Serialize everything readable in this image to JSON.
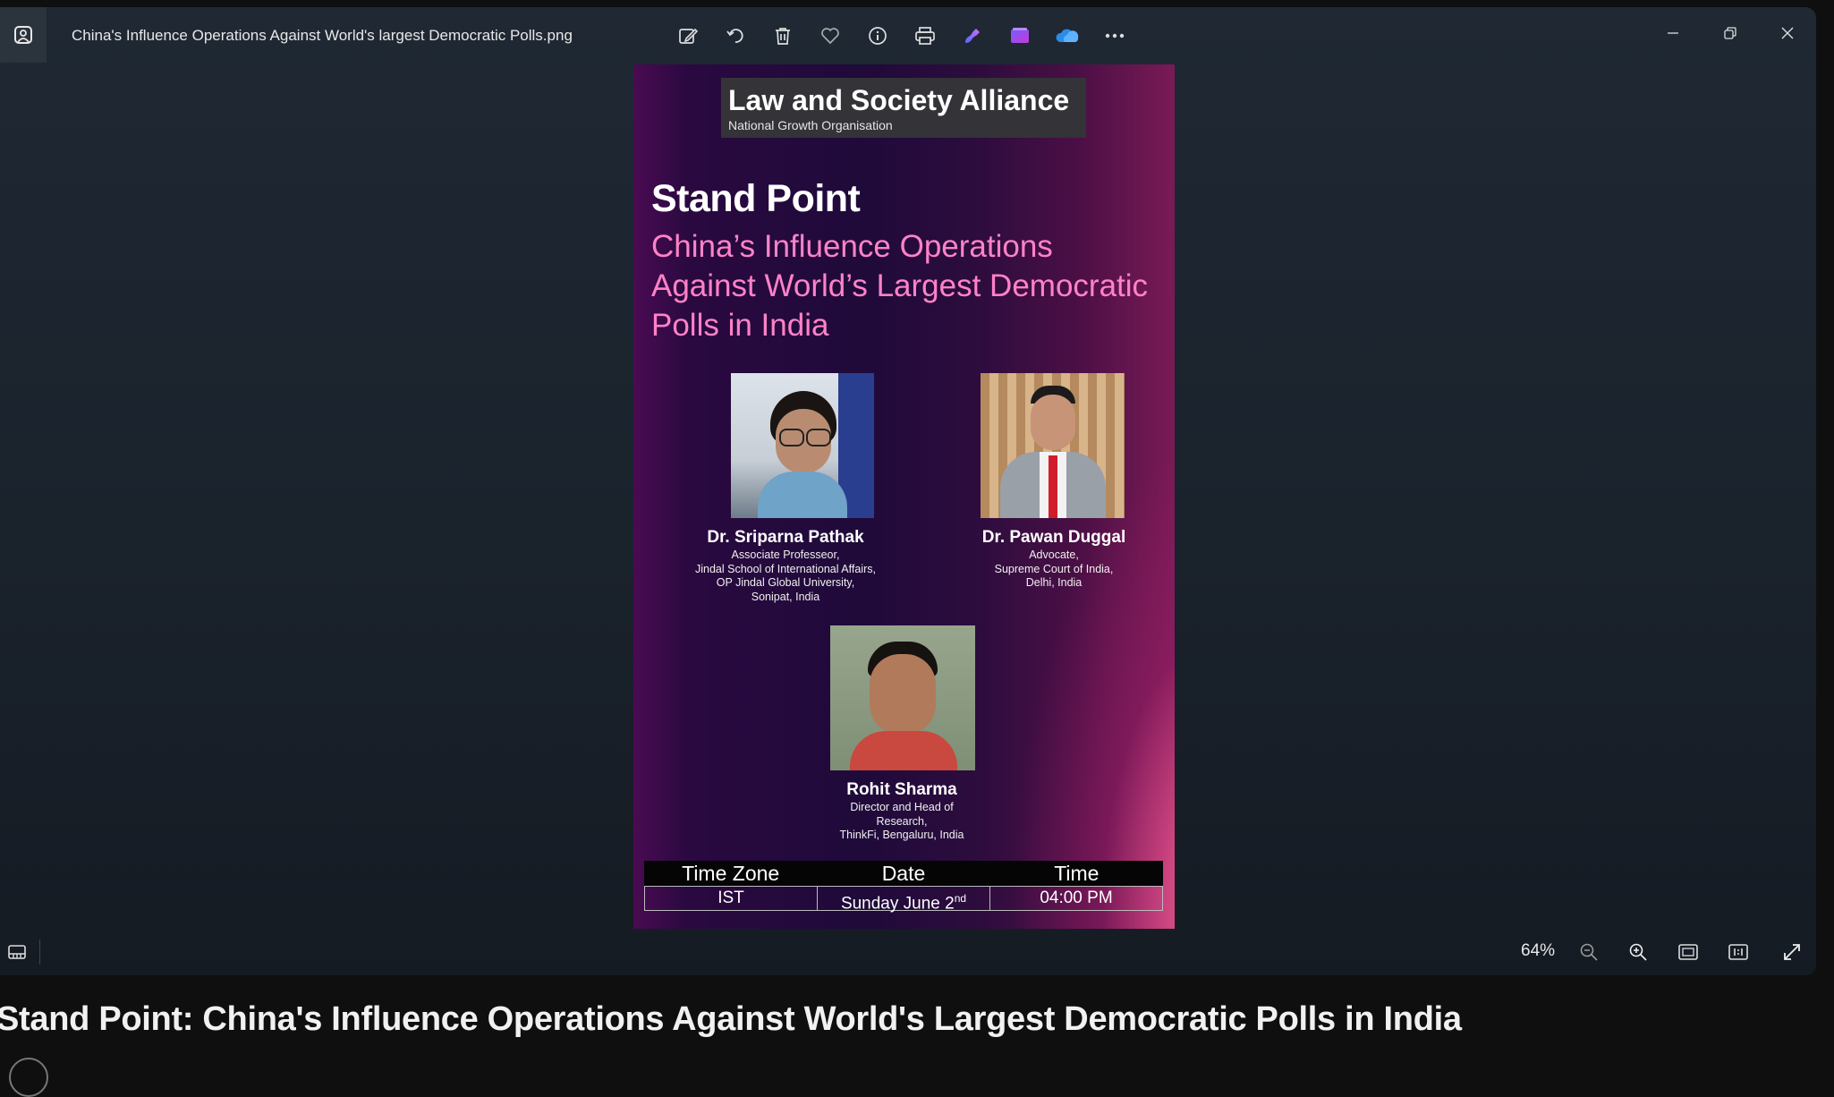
{
  "window": {
    "file_title": "China's Influence Operations Against World's largest Democratic Polls.png",
    "toolbar_icons": [
      "edit-image-icon",
      "rotate-icon",
      "delete-icon",
      "favorite-icon",
      "info-icon",
      "print-icon",
      "designer-icon",
      "clipchamp-icon",
      "onedrive-icon",
      "more-icon"
    ],
    "zoom": "64%"
  },
  "poster": {
    "org_name": "Law and Society Alliance",
    "org_sub": "National Growth Organisation",
    "headline": "Stand Point",
    "subhead": "China’s Influence Operations Against World’s Largest Democratic Polls in India",
    "speakers": [
      {
        "name": "Dr. Sriparna Pathak",
        "desc": "Associate Professeor,\nJindal School of International Affairs,\nOP Jindal Global University,\nSonipat, India"
      },
      {
        "name": "Dr. Pawan Duggal",
        "desc": "Advocate,\nSupreme Court of India,\nDelhi, India"
      },
      {
        "name": "Rohit Sharma",
        "desc": "Director and Head of\nResearch,\nThinkFi, Bengaluru, India"
      }
    ],
    "schedule": {
      "headers": [
        "Time Zone",
        "Date",
        "Time"
      ],
      "timezone": "IST",
      "date": "Sunday June 2",
      "date_sup": "nd",
      "time": "04:00 PM"
    }
  },
  "video_title": "Stand Point: China's Influence Operations Against World's Largest Democratic Polls in India",
  "colors": {
    "accent_pink": "#ff82c8",
    "poster_bg": "#1f0a3a",
    "viewer_bg": "#1f2833"
  }
}
